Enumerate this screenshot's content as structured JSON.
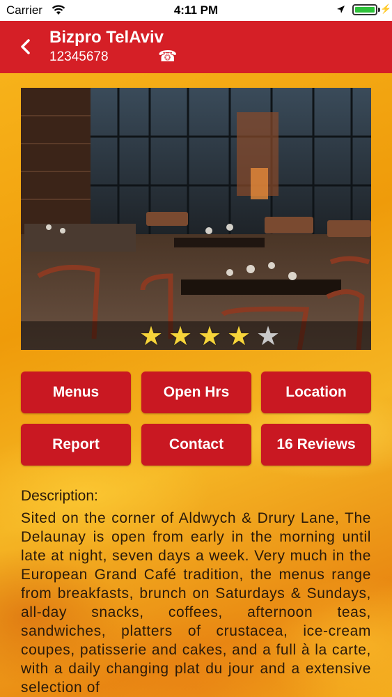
{
  "status_bar": {
    "carrier": "Carrier",
    "time": "4:11 PM"
  },
  "header": {
    "title": "Bizpro TelAviv",
    "phone": "12345678",
    "phone_icon": "telephone-icon",
    "back_icon": "chevron-left-icon",
    "background_color": "#d51f26"
  },
  "gallery": {
    "rating": 4,
    "max_rating": 5,
    "star_color": "#f6d43a"
  },
  "buttons": [
    {
      "label": "Menus"
    },
    {
      "label": "Open Hrs"
    },
    {
      "label": "Location"
    },
    {
      "label": "Report"
    },
    {
      "label": "Contact"
    },
    {
      "label": "16 Reviews"
    }
  ],
  "button_color": "#c91822",
  "description": {
    "label": "Description:",
    "text": "Sited on the corner of Aldwych & Drury Lane, The Delaunay is open from early in the morning until late at night, seven days a week.  Very much in the European Grand Café tradition, the menus range from breakfasts, brunch on Saturdays & Sundays, all-day snacks, coffees, afternoon teas, sandwiches, platters of crustacea, ice-cream coupes, patisserie and cakes, and a full à la carte, with a daily changing plat du jour and a extensive selection of"
  }
}
